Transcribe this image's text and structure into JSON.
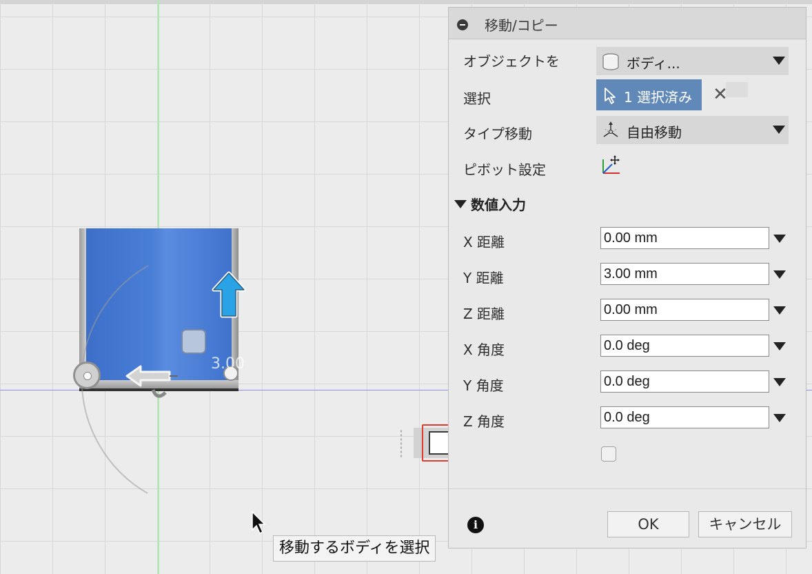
{
  "canvas": {
    "dimension_label": "3.00",
    "mini_input_value": "3.00 mm",
    "tooltip": "移動するボディを選択"
  },
  "panel": {
    "title": "移動/コピー",
    "rows": {
      "object_label": "オブジェクトを",
      "object_value": "ボディ...",
      "selection_label": "選択",
      "selection_value": "1 選択済み",
      "selection_clear": "✕",
      "type_label": "タイプ移動",
      "type_value": "自由移動",
      "pivot_label": "ピボット設定"
    },
    "section": "数値入力",
    "numeric": [
      {
        "label": "X 距離",
        "value": "0.00 mm"
      },
      {
        "label": "Y 距離",
        "value": "3.00 mm"
      },
      {
        "label": "Z 距離",
        "value": "0.00 mm"
      },
      {
        "label": "X 角度",
        "value": "0.0 deg"
      },
      {
        "label": "Y 角度",
        "value": "0.0 deg"
      },
      {
        "label": "Z 角度",
        "value": "0.0 deg"
      }
    ],
    "info_glyph": "i",
    "ok_label": "OK",
    "cancel_label": "キャンセル"
  },
  "colors": {
    "selection_button": "#6088b8",
    "body_face": "#4a7fd6",
    "highlight_border": "#e23b2f",
    "move_arrow": "#2aa3e6"
  },
  "icons": [
    "collapse-icon",
    "body-icon",
    "cursor-select-icon",
    "free-move-icon",
    "pivot-icon",
    "info-icon",
    "up-arrow-icon",
    "left-arrow-icon"
  ]
}
